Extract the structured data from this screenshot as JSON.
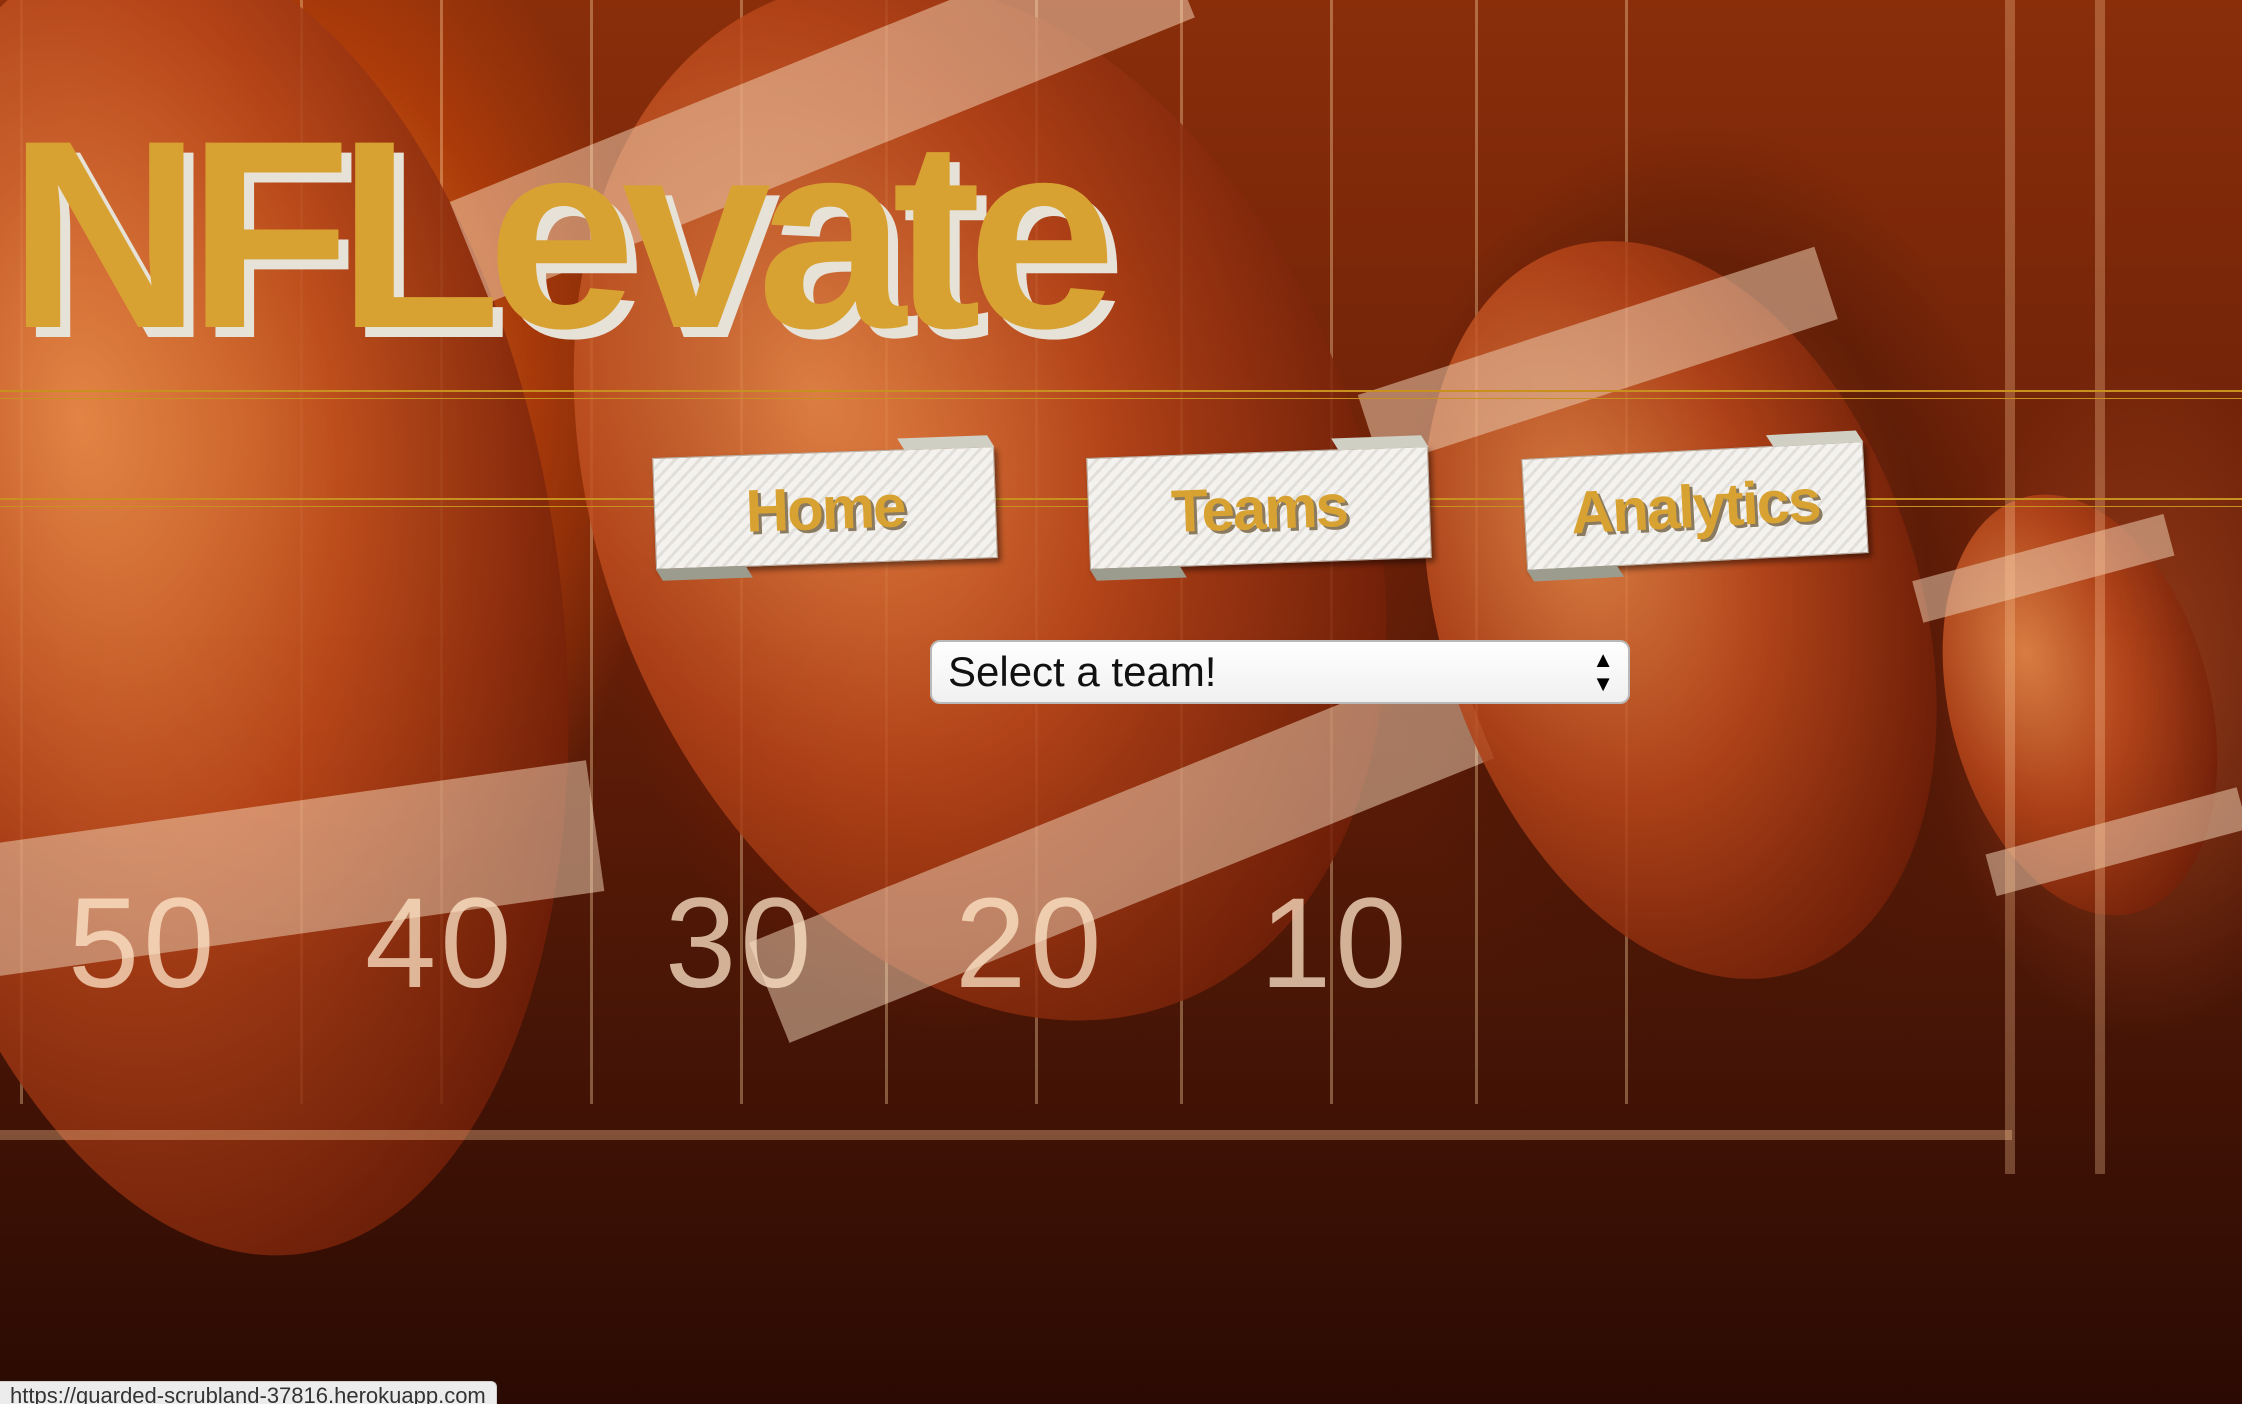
{
  "site": {
    "title": "NFLevate"
  },
  "nav": {
    "items": [
      {
        "label": "Home"
      },
      {
        "label": "Teams"
      },
      {
        "label": "Analytics"
      }
    ]
  },
  "team_select": {
    "selected": "Select a team!"
  },
  "background": {
    "yard_numbers": [
      "50",
      "40",
      "30",
      "20",
      "10"
    ]
  },
  "status_bar": {
    "url": "https://guarded-scrubland-37816.herokuapp.com"
  },
  "colors": {
    "brand_gold": "#d8a233",
    "accent_line": "#c8901e"
  }
}
